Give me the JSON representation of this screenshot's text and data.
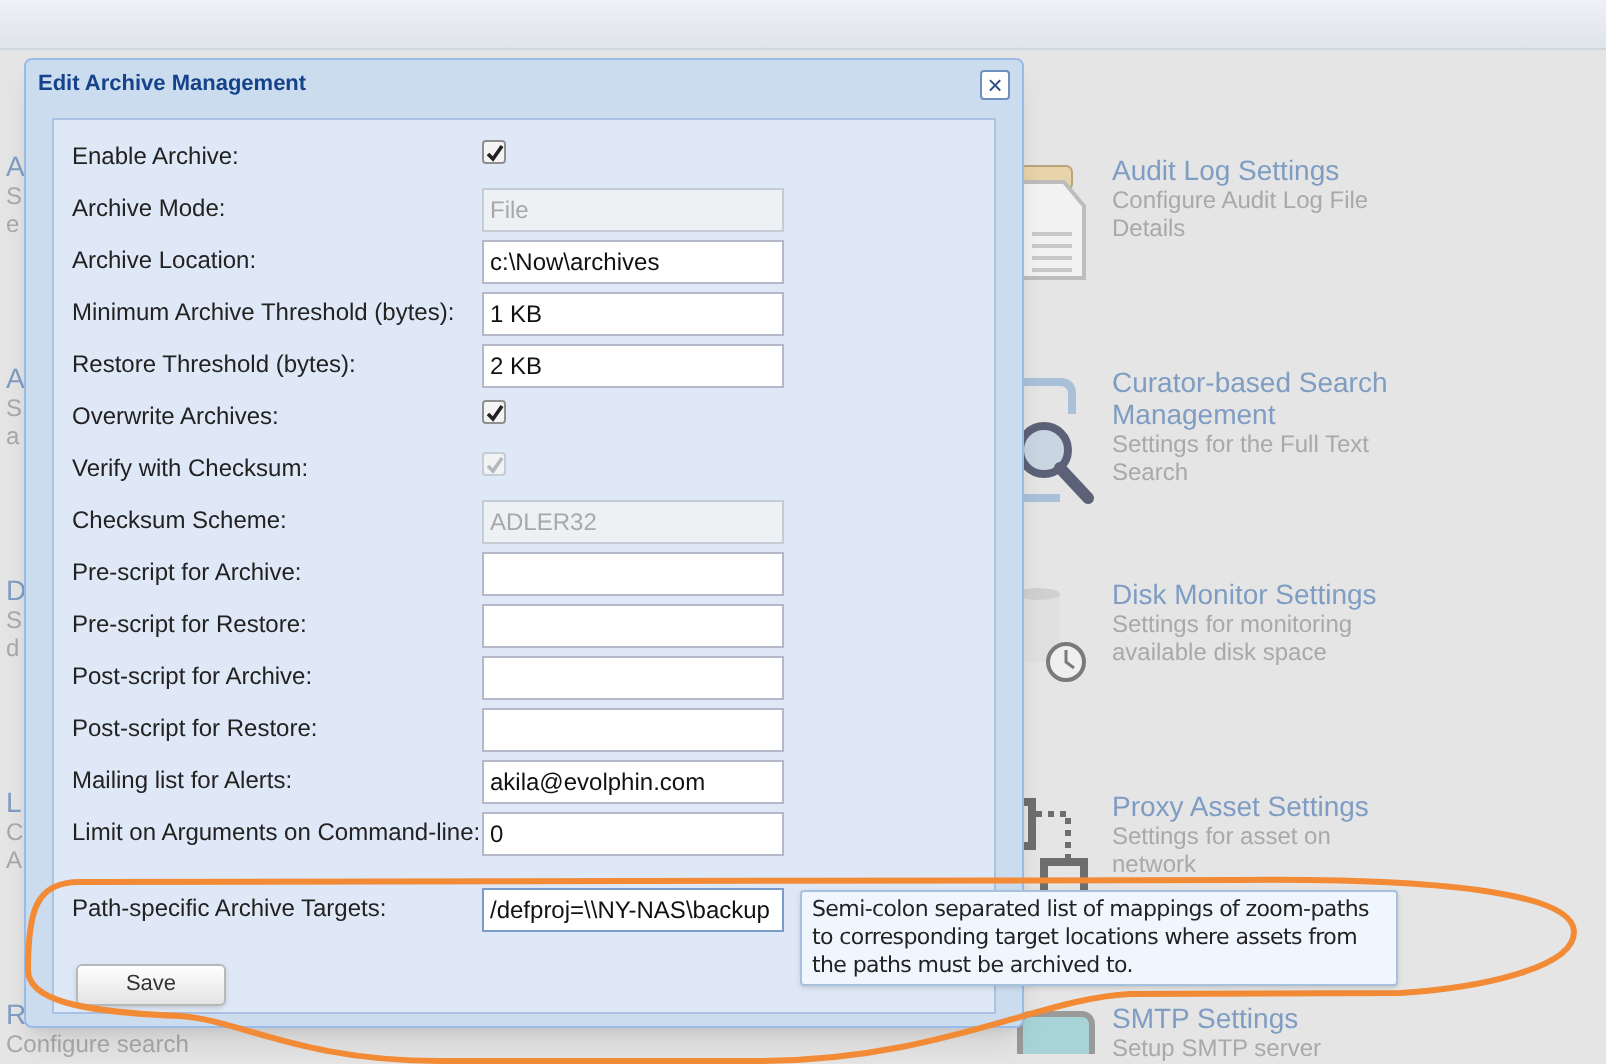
{
  "left_fragments": [
    {
      "title": "A",
      "lines": [
        "S",
        "e"
      ]
    },
    {
      "title": "A",
      "lines": [
        "S",
        "a"
      ]
    },
    {
      "title": "D",
      "lines": [
        "S",
        "d"
      ]
    },
    {
      "title": "L",
      "lines": [
        "C",
        "A"
      ]
    },
    {
      "title": "R",
      "lines": [
        "Configure search"
      ]
    }
  ],
  "settings": [
    {
      "title": "Audit Log Settings",
      "subtitle": [
        "Configure Audit Log File",
        "Details"
      ]
    },
    {
      "title": "Curator-based Search Management",
      "subtitle": [
        "Settings for the Full Text",
        "Search"
      ]
    },
    {
      "title": "Disk Monitor Settings",
      "subtitle": [
        "Settings for monitoring",
        "available disk space"
      ]
    },
    {
      "title": "Proxy Asset Settings",
      "subtitle": [
        "Settings for asset on",
        "network"
      ]
    },
    {
      "title": "SMTP Settings",
      "subtitle": [
        "Setup SMTP server"
      ]
    }
  ],
  "dialog": {
    "title": "Edit Archive Management",
    "close": "×",
    "fields": [
      {
        "kind": "checkbox",
        "label": "Enable Archive:",
        "checked": true,
        "disabled": false
      },
      {
        "kind": "text",
        "label": "Archive Mode:",
        "value": "File",
        "disabled": true
      },
      {
        "kind": "text",
        "label": "Archive Location:",
        "value": "c:\\Now\\archives",
        "disabled": false
      },
      {
        "kind": "text",
        "label": "Minimum Archive Threshold (bytes):",
        "value": "1 KB",
        "disabled": false
      },
      {
        "kind": "text",
        "label": "Restore Threshold (bytes):",
        "value": "2 KB",
        "disabled": false
      },
      {
        "kind": "checkbox",
        "label": "Overwrite Archives:",
        "checked": true,
        "disabled": false
      },
      {
        "kind": "checkbox",
        "label": "Verify with Checksum:",
        "checked": true,
        "disabled": true
      },
      {
        "kind": "text",
        "label": "Checksum Scheme:",
        "value": "ADLER32",
        "disabled": true
      },
      {
        "kind": "text",
        "label": "Pre-script for Archive:",
        "disabled": false
      },
      {
        "kind": "text",
        "label": "Pre-script for Restore:",
        "disabled": false
      },
      {
        "kind": "text",
        "label": "Post-script for Archive:",
        "disabled": false
      },
      {
        "kind": "text",
        "label": "Post-script for Restore:",
        "disabled": false
      },
      {
        "kind": "text",
        "label": "Mailing list for Alerts:",
        "value": "akila@evolphin.com",
        "disabled": false
      },
      {
        "kind": "text",
        "label": "Limit on Arguments on Command-line:",
        "value": "0",
        "disabled": false
      },
      {
        "kind": "text",
        "label": "Path-specific Archive Targets:",
        "value": "/defproj=\\\\NY-NAS\\backup",
        "disabled": false,
        "focused": true
      }
    ],
    "tooltip": "Semi-colon separated list of mappings of zoom-paths to corresponding target locations where assets from the paths must be archived to.",
    "save_button": "Save"
  },
  "annotation": {
    "kind": "ellipse",
    "color": "#f28a36"
  }
}
